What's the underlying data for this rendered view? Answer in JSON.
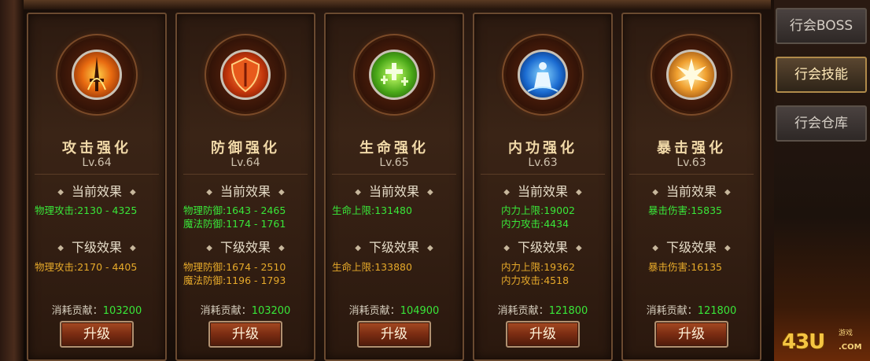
{
  "side_tabs": [
    "行会BOSS",
    "行会技能",
    "行会仓库"
  ],
  "section_labels": {
    "current": "当前效果",
    "next": "下级效果",
    "cost": "消耗贡献："
  },
  "upgrade_label": "升级",
  "skills": [
    {
      "name": "攻击强化",
      "level": "Lv.64",
      "icon": "flaming-sword-icon",
      "current": [
        "物理攻击:2130 - 4325"
      ],
      "next": [
        "物理攻击:2170 - 4405"
      ],
      "cost": "103200"
    },
    {
      "name": "防御强化",
      "level": "Lv.64",
      "icon": "shield-icon",
      "current": [
        "物理防御:1643 - 2465",
        "魔法防御:1174 - 1761"
      ],
      "next": [
        "物理防御:1674 - 2510",
        "魔法防御:1196 - 1793"
      ],
      "cost": "103200"
    },
    {
      "name": "生命强化",
      "level": "Lv.65",
      "icon": "healing-plus-icon",
      "current": [
        "生命上限:131480"
      ],
      "next": [
        "生命上限:133880"
      ],
      "cost": "104900"
    },
    {
      "name": "内功强化",
      "level": "Lv.63",
      "icon": "meditating-figure-icon",
      "current": [
        "内力上限:19002",
        "内力攻击:4434"
      ],
      "next": [
        "内力上限:19362",
        "内力攻击:4518"
      ],
      "cost": "121800"
    },
    {
      "name": "暴击强化",
      "level": "Lv.63",
      "icon": "burst-explosion-icon",
      "current": [
        "暴击伤害:15835"
      ],
      "next": [
        "暴击伤害:16135"
      ],
      "cost": "121800"
    }
  ],
  "logo": {
    "main": "43U",
    "small": "游戏",
    "domain": ".COM"
  }
}
